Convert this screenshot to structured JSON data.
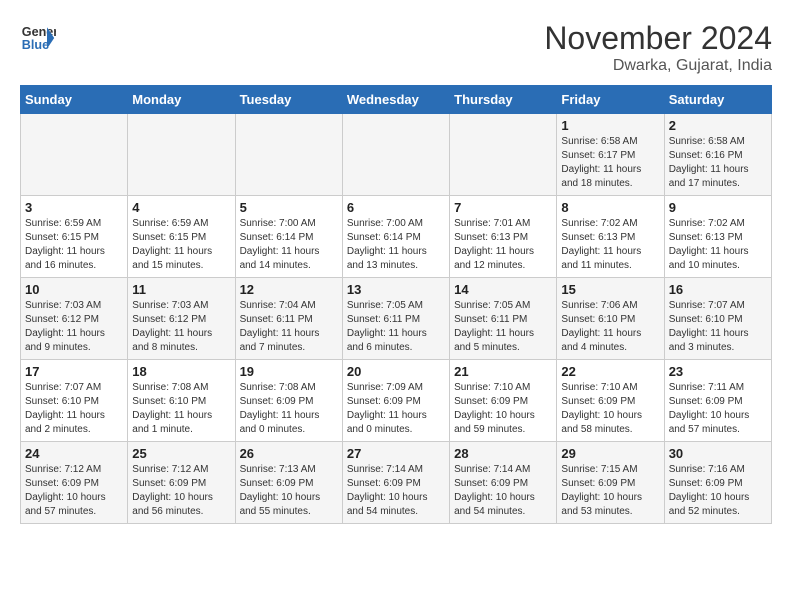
{
  "header": {
    "logo_line1": "General",
    "logo_line2": "Blue",
    "month_year": "November 2024",
    "location": "Dwarka, Gujarat, India"
  },
  "days_of_week": [
    "Sunday",
    "Monday",
    "Tuesday",
    "Wednesday",
    "Thursday",
    "Friday",
    "Saturday"
  ],
  "weeks": [
    [
      {
        "day": "",
        "info": ""
      },
      {
        "day": "",
        "info": ""
      },
      {
        "day": "",
        "info": ""
      },
      {
        "day": "",
        "info": ""
      },
      {
        "day": "",
        "info": ""
      },
      {
        "day": "1",
        "info": "Sunrise: 6:58 AM\nSunset: 6:17 PM\nDaylight: 11 hours and 18 minutes."
      },
      {
        "day": "2",
        "info": "Sunrise: 6:58 AM\nSunset: 6:16 PM\nDaylight: 11 hours and 17 minutes."
      }
    ],
    [
      {
        "day": "3",
        "info": "Sunrise: 6:59 AM\nSunset: 6:15 PM\nDaylight: 11 hours and 16 minutes."
      },
      {
        "day": "4",
        "info": "Sunrise: 6:59 AM\nSunset: 6:15 PM\nDaylight: 11 hours and 15 minutes."
      },
      {
        "day": "5",
        "info": "Sunrise: 7:00 AM\nSunset: 6:14 PM\nDaylight: 11 hours and 14 minutes."
      },
      {
        "day": "6",
        "info": "Sunrise: 7:00 AM\nSunset: 6:14 PM\nDaylight: 11 hours and 13 minutes."
      },
      {
        "day": "7",
        "info": "Sunrise: 7:01 AM\nSunset: 6:13 PM\nDaylight: 11 hours and 12 minutes."
      },
      {
        "day": "8",
        "info": "Sunrise: 7:02 AM\nSunset: 6:13 PM\nDaylight: 11 hours and 11 minutes."
      },
      {
        "day": "9",
        "info": "Sunrise: 7:02 AM\nSunset: 6:13 PM\nDaylight: 11 hours and 10 minutes."
      }
    ],
    [
      {
        "day": "10",
        "info": "Sunrise: 7:03 AM\nSunset: 6:12 PM\nDaylight: 11 hours and 9 minutes."
      },
      {
        "day": "11",
        "info": "Sunrise: 7:03 AM\nSunset: 6:12 PM\nDaylight: 11 hours and 8 minutes."
      },
      {
        "day": "12",
        "info": "Sunrise: 7:04 AM\nSunset: 6:11 PM\nDaylight: 11 hours and 7 minutes."
      },
      {
        "day": "13",
        "info": "Sunrise: 7:05 AM\nSunset: 6:11 PM\nDaylight: 11 hours and 6 minutes."
      },
      {
        "day": "14",
        "info": "Sunrise: 7:05 AM\nSunset: 6:11 PM\nDaylight: 11 hours and 5 minutes."
      },
      {
        "day": "15",
        "info": "Sunrise: 7:06 AM\nSunset: 6:10 PM\nDaylight: 11 hours and 4 minutes."
      },
      {
        "day": "16",
        "info": "Sunrise: 7:07 AM\nSunset: 6:10 PM\nDaylight: 11 hours and 3 minutes."
      }
    ],
    [
      {
        "day": "17",
        "info": "Sunrise: 7:07 AM\nSunset: 6:10 PM\nDaylight: 11 hours and 2 minutes."
      },
      {
        "day": "18",
        "info": "Sunrise: 7:08 AM\nSunset: 6:10 PM\nDaylight: 11 hours and 1 minute."
      },
      {
        "day": "19",
        "info": "Sunrise: 7:08 AM\nSunset: 6:09 PM\nDaylight: 11 hours and 0 minutes."
      },
      {
        "day": "20",
        "info": "Sunrise: 7:09 AM\nSunset: 6:09 PM\nDaylight: 11 hours and 0 minutes."
      },
      {
        "day": "21",
        "info": "Sunrise: 7:10 AM\nSunset: 6:09 PM\nDaylight: 10 hours and 59 minutes."
      },
      {
        "day": "22",
        "info": "Sunrise: 7:10 AM\nSunset: 6:09 PM\nDaylight: 10 hours and 58 minutes."
      },
      {
        "day": "23",
        "info": "Sunrise: 7:11 AM\nSunset: 6:09 PM\nDaylight: 10 hours and 57 minutes."
      }
    ],
    [
      {
        "day": "24",
        "info": "Sunrise: 7:12 AM\nSunset: 6:09 PM\nDaylight: 10 hours and 57 minutes."
      },
      {
        "day": "25",
        "info": "Sunrise: 7:12 AM\nSunset: 6:09 PM\nDaylight: 10 hours and 56 minutes."
      },
      {
        "day": "26",
        "info": "Sunrise: 7:13 AM\nSunset: 6:09 PM\nDaylight: 10 hours and 55 minutes."
      },
      {
        "day": "27",
        "info": "Sunrise: 7:14 AM\nSunset: 6:09 PM\nDaylight: 10 hours and 54 minutes."
      },
      {
        "day": "28",
        "info": "Sunrise: 7:14 AM\nSunset: 6:09 PM\nDaylight: 10 hours and 54 minutes."
      },
      {
        "day": "29",
        "info": "Sunrise: 7:15 AM\nSunset: 6:09 PM\nDaylight: 10 hours and 53 minutes."
      },
      {
        "day": "30",
        "info": "Sunrise: 7:16 AM\nSunset: 6:09 PM\nDaylight: 10 hours and 52 minutes."
      }
    ]
  ]
}
